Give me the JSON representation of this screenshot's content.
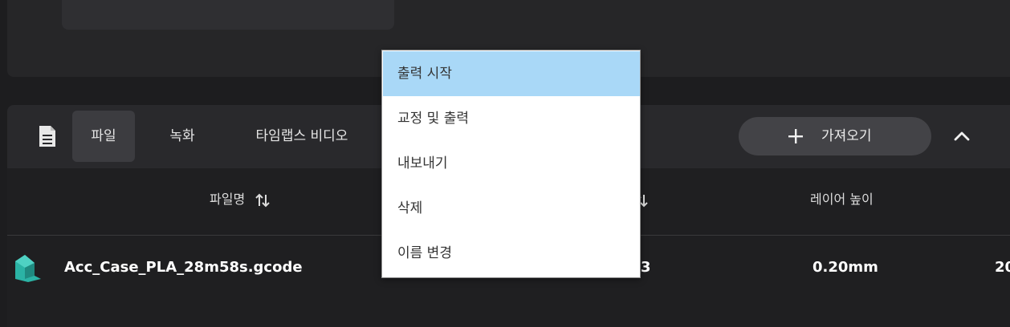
{
  "tabs": [
    {
      "label": "파일",
      "active": true
    },
    {
      "label": "녹화",
      "active": false
    },
    {
      "label": "타임랩스 비디오",
      "active": false
    }
  ],
  "import_button": {
    "label": "가져오기",
    "icon": "plus-icon"
  },
  "columns": {
    "filename": "파일명",
    "layer_height": "레이어 높이"
  },
  "file_row": {
    "name": "Acc_Case_PLA_28m58s.gcode",
    "partial_value": "3",
    "layer_height": "0.20mm",
    "partial_trailing": "20",
    "icon": "model-file-icon"
  },
  "context_menu": {
    "items": [
      {
        "label": "출력 시작",
        "highlighted": true
      },
      {
        "label": "교정 및 출력",
        "highlighted": false
      },
      {
        "label": "내보내기",
        "highlighted": false
      },
      {
        "label": "삭제",
        "highlighted": false
      },
      {
        "label": "이름 변경",
        "highlighted": false
      }
    ]
  },
  "colors": {
    "menu_highlight": "#a9d8f7",
    "file_icon": "#2bb3a5"
  }
}
